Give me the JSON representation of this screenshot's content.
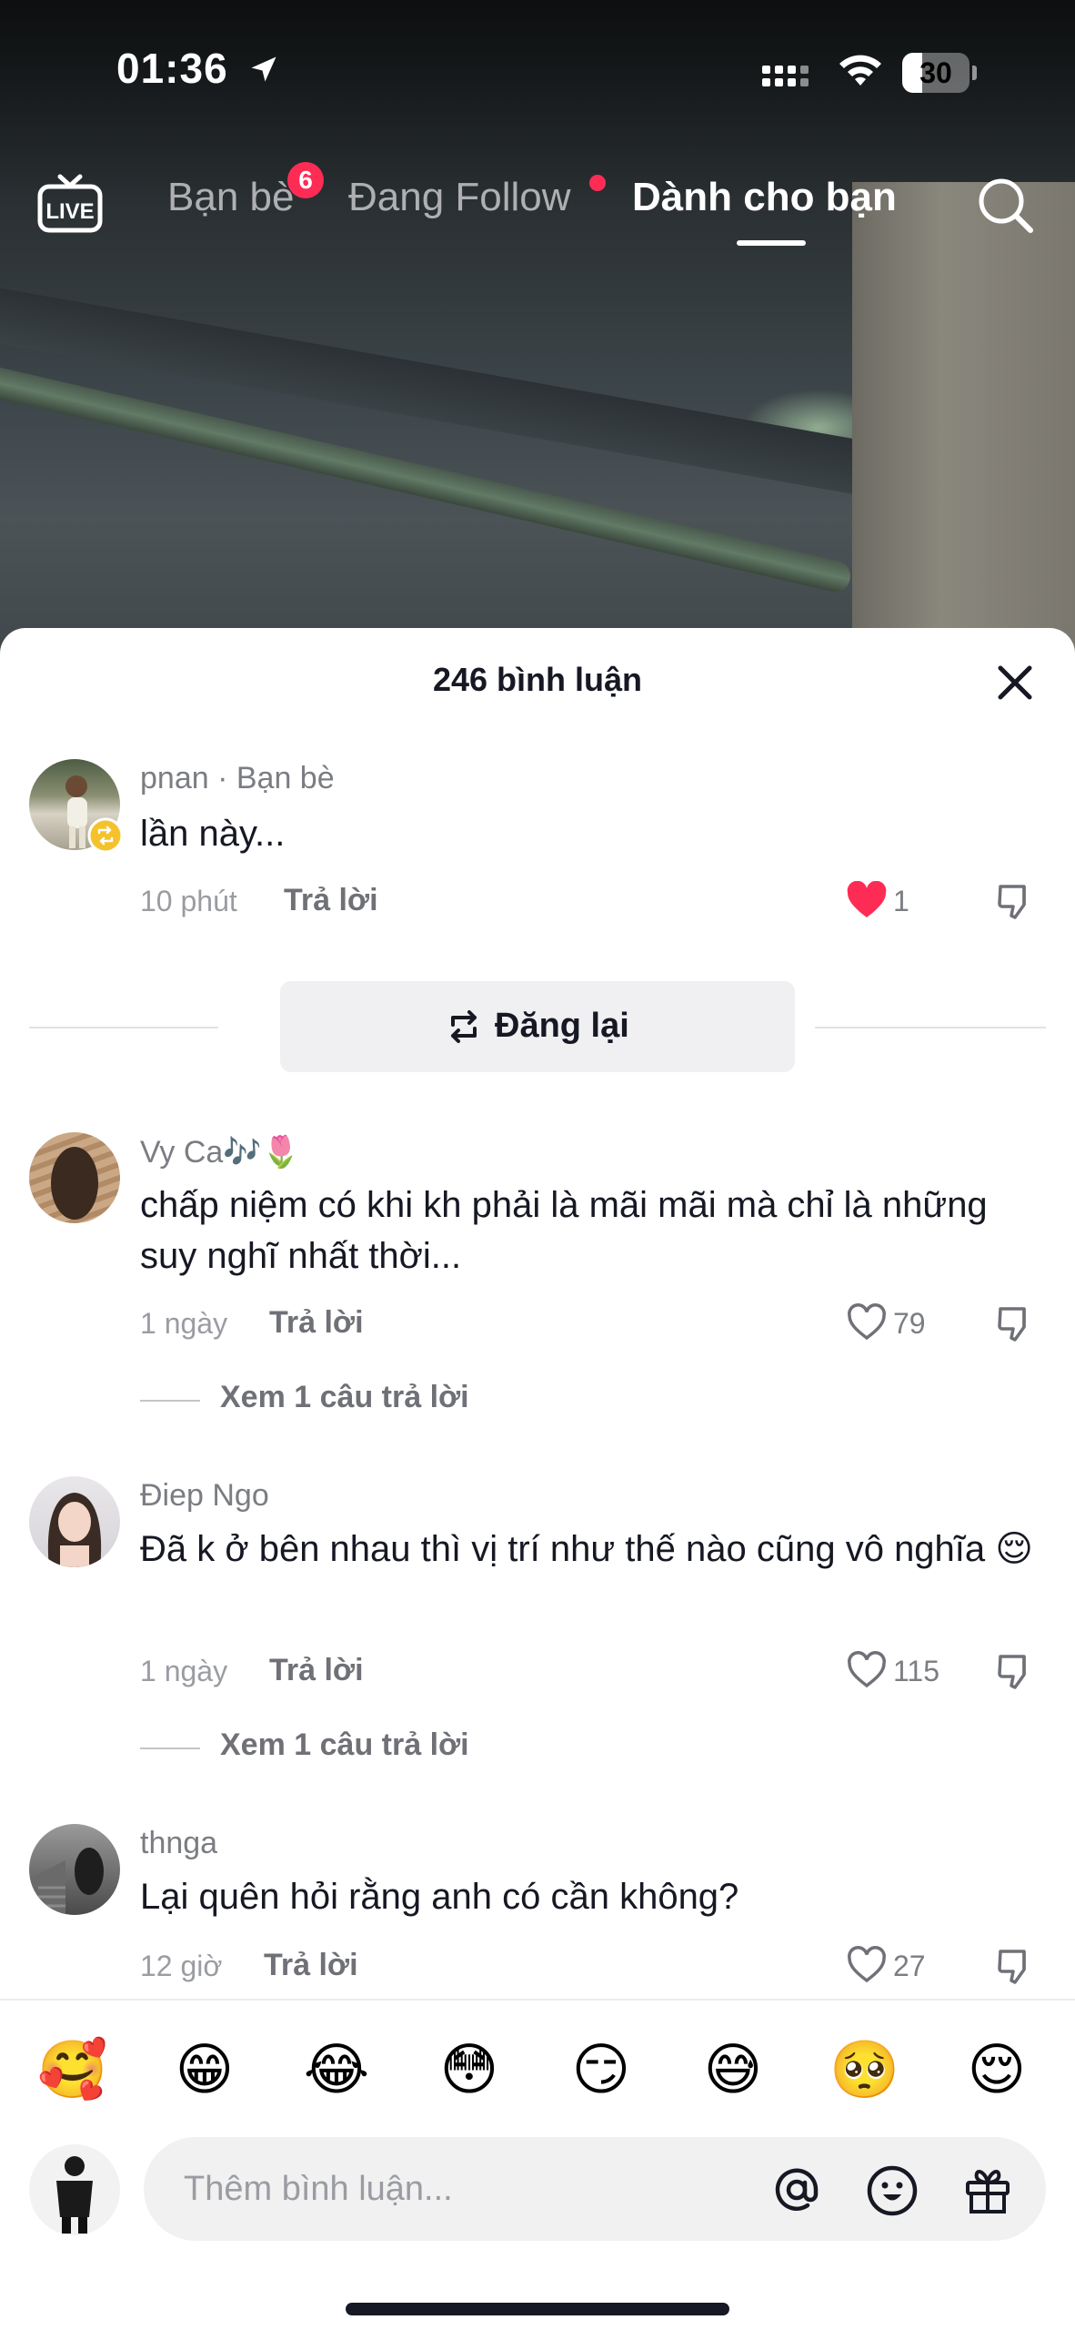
{
  "status_bar": {
    "time": "01:36",
    "battery": "30",
    "battery_level": 0.3
  },
  "top_nav": {
    "tabs": [
      {
        "label": "Bạn bè",
        "badge": "6"
      },
      {
        "label": "Đang Follow",
        "dot": true
      },
      {
        "label": "Dành cho bạn",
        "active": true
      }
    ]
  },
  "sheet": {
    "title": "246 bình luận"
  },
  "comments": [
    {
      "user": "pnan · Bạn bè",
      "text": "lần này...",
      "time": "10 phút",
      "reply": "Trả lời",
      "likes": "1",
      "liked": true
    },
    {
      "user": "Vy Ca🎶🌷",
      "text": "chấp niệm có khi kh phải là mãi mãi mà chỉ là những suy nghĩ nhất thời...",
      "time": "1 ngày",
      "reply": "Trả lời",
      "likes": "79",
      "view_replies": "Xem 1 câu trả lời"
    },
    {
      "user": "Điep Ngo",
      "text": "Đã k ở bên nhau thì vị trí như thế nào cũng vô nghĩa 😌",
      "time": "1 ngày",
      "reply": "Trả lời",
      "likes": "115",
      "view_replies": "Xem 1 câu trả lời"
    },
    {
      "user": "thnga",
      "text": "Lại quên hỏi rằng anh có cần không?",
      "time": "12 giờ",
      "reply": "Trả lời",
      "likes": "27"
    }
  ],
  "repost": {
    "label": "Đăng lại"
  },
  "emoji_bar": [
    "🥰",
    "😁",
    "😂",
    "😳",
    "😏",
    "😅",
    "🥺",
    "😌"
  ],
  "input": {
    "placeholder": "Thêm bình luận..."
  },
  "colors": {
    "accent": "#fe2c55",
    "text": "#161823",
    "muted": "#7b7d83"
  },
  "icons": [
    "location-arrow-icon",
    "signal-icon",
    "wifi-icon",
    "battery-icon",
    "live-icon",
    "search-icon",
    "close-icon",
    "heart-icon",
    "dislike-icon",
    "repost-icon",
    "at-icon",
    "emoji-icon",
    "gift-icon"
  ]
}
